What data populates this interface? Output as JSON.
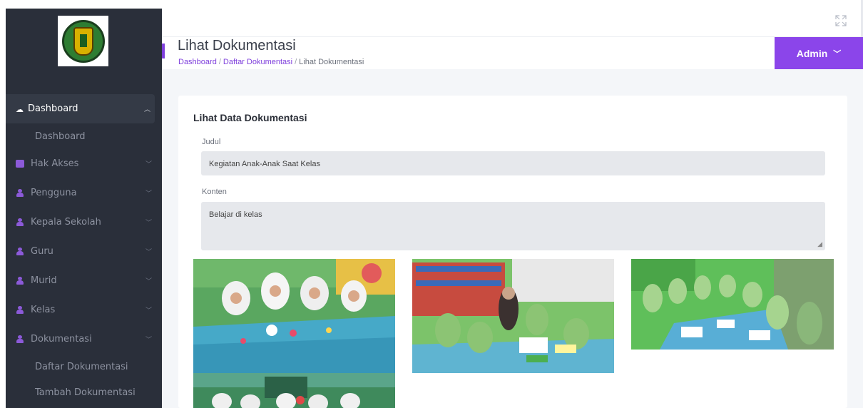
{
  "sidebar": {
    "items": [
      {
        "label": "Dashboard",
        "icon": "dashboard-icon",
        "expanded": true
      },
      {
        "label": "Hak Akses",
        "icon": "list-icon"
      },
      {
        "label": "Pengguna",
        "icon": "user-icon"
      },
      {
        "label": "Kepala Sekolah",
        "icon": "user-icon"
      },
      {
        "label": "Guru",
        "icon": "user-icon"
      },
      {
        "label": "Murid",
        "icon": "user-icon"
      },
      {
        "label": "Kelas",
        "icon": "user-icon"
      },
      {
        "label": "Dokumentasi",
        "icon": "user-icon",
        "expanded": true
      }
    ],
    "dashboard_sub": [
      "Dashboard"
    ],
    "dokumentasi_sub": [
      "Daftar Dokumentasi",
      "Tambah Dokumentasi"
    ]
  },
  "header": {
    "title": "Lihat Dokumentasi",
    "breadcrumb": [
      "Dashboard",
      "Daftar Dokumentasi",
      "Lihat Dokumentasi"
    ],
    "user_menu": "Admin"
  },
  "card": {
    "title": "Lihat Data Dokumentasi",
    "judul_label": "Judul",
    "judul_value": "Kegiatan Anak-Anak Saat Kelas",
    "konten_label": "Konten",
    "konten_value": "Belajar di kelas"
  },
  "colors": {
    "accent": "#8b45ea",
    "sidebar_bg": "#2a2f3a",
    "content_bg": "#f4f6f9"
  }
}
